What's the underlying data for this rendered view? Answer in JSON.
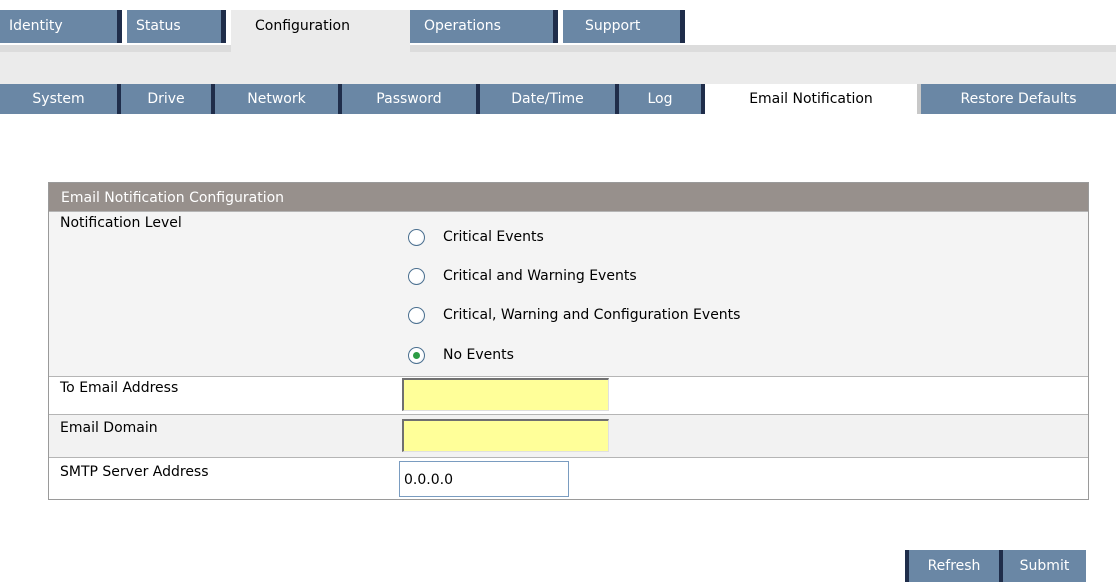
{
  "top_tabs": [
    {
      "label": "Identity",
      "active": false
    },
    {
      "label": "Status",
      "active": false
    },
    {
      "label": "Configuration",
      "active": true
    },
    {
      "label": "Operations",
      "active": false
    },
    {
      "label": "Support",
      "active": false
    }
  ],
  "sub_tabs": [
    {
      "label": "System",
      "active": false
    },
    {
      "label": "Drive",
      "active": false
    },
    {
      "label": "Network",
      "active": false
    },
    {
      "label": "Password",
      "active": false
    },
    {
      "label": "Date/Time",
      "active": false
    },
    {
      "label": "Log",
      "active": false
    },
    {
      "label": "Email Notification",
      "active": true
    },
    {
      "label": "Restore Defaults",
      "active": false
    }
  ],
  "panel": {
    "title": "Email Notification Configuration",
    "notification_level": {
      "label": "Notification Level",
      "options": [
        {
          "label": "Critical Events",
          "checked": false
        },
        {
          "label": "Critical and Warning Events",
          "checked": false
        },
        {
          "label": "Critical, Warning and Configuration Events",
          "checked": false
        },
        {
          "label": "No Events",
          "checked": true
        }
      ]
    },
    "to_email": {
      "label": "To Email Address",
      "value": ""
    },
    "email_domain": {
      "label": "Email Domain",
      "value": ""
    },
    "smtp_server": {
      "label": "SMTP Server Address",
      "value": "0.0.0.0"
    }
  },
  "buttons": {
    "refresh": "Refresh",
    "submit": "Submit"
  },
  "colors": {
    "tab_bg": "#6a87a5",
    "tab_edge": "#1f2d4a",
    "panel_header": "#97908c",
    "required_field": "#ffff99",
    "radio_checked": "#2d9c44"
  }
}
